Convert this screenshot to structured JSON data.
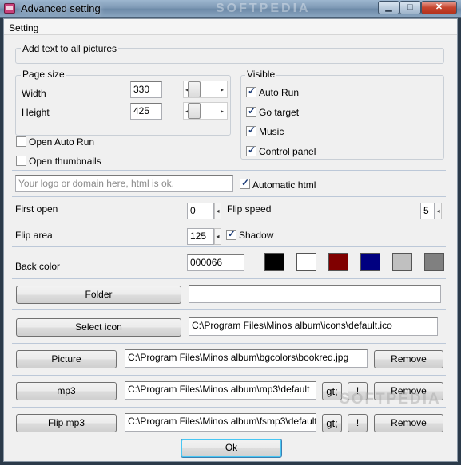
{
  "window": {
    "title": "Advanced setting",
    "watermark_top": "SOFTPEDIA",
    "controls": {
      "minimize": "▁",
      "maximize": "□",
      "close": "✕"
    }
  },
  "menu": {
    "setting": "Setting"
  },
  "add_text_group": {
    "title": "Add text to all pictures",
    "value": ""
  },
  "page_size": {
    "title": "Page size",
    "width_label": "Width",
    "width_value": "330",
    "height_label": "Height",
    "height_value": "425"
  },
  "visible": {
    "title": "Visible",
    "items": [
      {
        "label": "Auto Run",
        "checked": true
      },
      {
        "label": "Go target",
        "checked": true
      },
      {
        "label": "Music",
        "checked": true
      },
      {
        "label": "Control panel",
        "checked": true
      }
    ]
  },
  "open_auto_run": {
    "label": "Open Auto Run",
    "checked": false
  },
  "open_thumbnails": {
    "label": "Open thumbnails",
    "checked": false
  },
  "logo_input": {
    "placeholder": "Your logo or domain here, html is ok."
  },
  "automatic_html": {
    "label": "Automatic html",
    "checked": true
  },
  "first_open": {
    "label": "First open",
    "value": "0"
  },
  "flip_speed": {
    "label": "Flip speed",
    "value": "5"
  },
  "flip_area": {
    "label": "Flip area",
    "value": "125"
  },
  "shadow": {
    "label": "Shadow",
    "checked": true
  },
  "back_color": {
    "label": "Back color",
    "value": "000066",
    "swatches": [
      "#000000",
      "#ffffff",
      "#800000",
      "#000080",
      "#c0c0c0",
      "#808080"
    ]
  },
  "folder": {
    "button": "Folder",
    "path": ""
  },
  "select_icon": {
    "button": "Select icon",
    "path": "C:\\Program Files\\Minos album\\icons\\default.ico"
  },
  "picture": {
    "button": "Picture",
    "path": "C:\\Program Files\\Minos album\\bgcolors\\bookred.jpg",
    "remove": "Remove"
  },
  "mp3": {
    "button": "mp3",
    "path": "C:\\Program Files\\Minos album\\mp3\\default",
    "gt": "gt;",
    "excl": "!",
    "remove": "Remove"
  },
  "flip_mp3": {
    "button": "Flip mp3",
    "path": "C:\\Program Files\\Minos album\\fsmp3\\default",
    "gt": "gt;",
    "excl": "!",
    "remove": "Remove"
  },
  "ok_button": "Ok",
  "watermark_bottom": "SOFTPEDIA",
  "icons": [
    "app-icon",
    "minimize-icon",
    "maximize-icon",
    "close-icon",
    "spin-arrow-icon",
    "trackbar-thumb-icon",
    "checkmark-icon"
  ]
}
